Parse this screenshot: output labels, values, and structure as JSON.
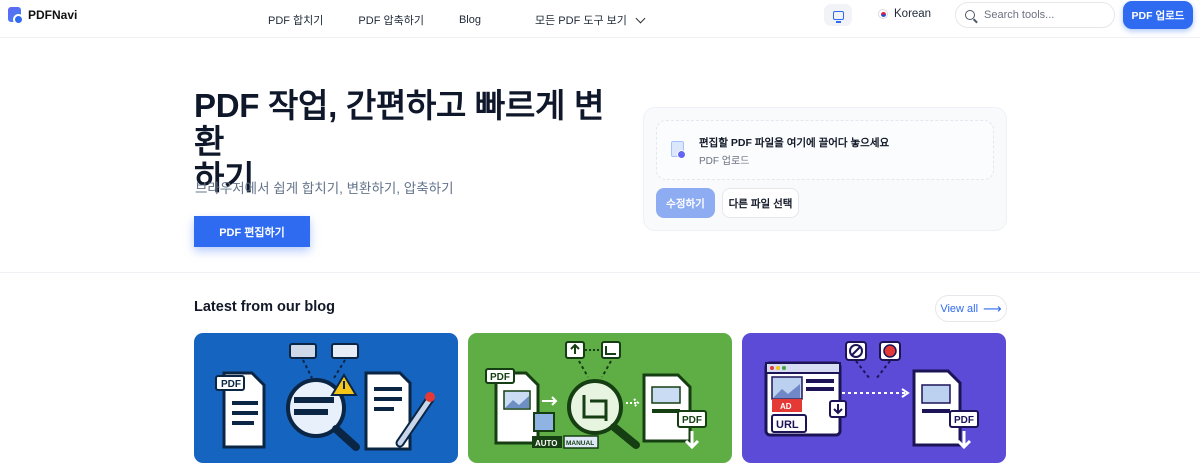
{
  "nav": {
    "logo": "PDFNavi",
    "links": [
      "PDF 합치기",
      "PDF 압축하기",
      "Blog",
      "모든 PDF 도구 보기"
    ],
    "language": "Korean",
    "search_placeholder": "Search tools...",
    "upload_label": "PDF 업로드"
  },
  "hero": {
    "title_line1": "PDF 작업, 간편하고 빠르게 변환",
    "title_line2": "하기",
    "subtitle": "브라우저에서 쉽게 합치기, 변환하기, 압축하기",
    "cta": "PDF 편집하기"
  },
  "upload_panel": {
    "drop_title": "편집할 PDF 파일을 여기에 끌어다 놓으세요",
    "drop_sub": "PDF 업로드",
    "edit_button": "수정하기",
    "other_button": "다른 파일 선택"
  },
  "blog": {
    "heading": "Latest from our blog",
    "view_all": "View all",
    "cards": [
      {
        "bg": "#1565c0",
        "labels": [
          "PDF"
        ]
      },
      {
        "bg": "#5fae45",
        "labels": [
          "PDF",
          "PDF",
          "AUTO",
          "MANUAL"
        ]
      },
      {
        "bg": "#5b4bd6",
        "labels": [
          "AD",
          "URL",
          "PDF"
        ]
      }
    ]
  },
  "colors": {
    "primary": "#2f6bf0"
  }
}
